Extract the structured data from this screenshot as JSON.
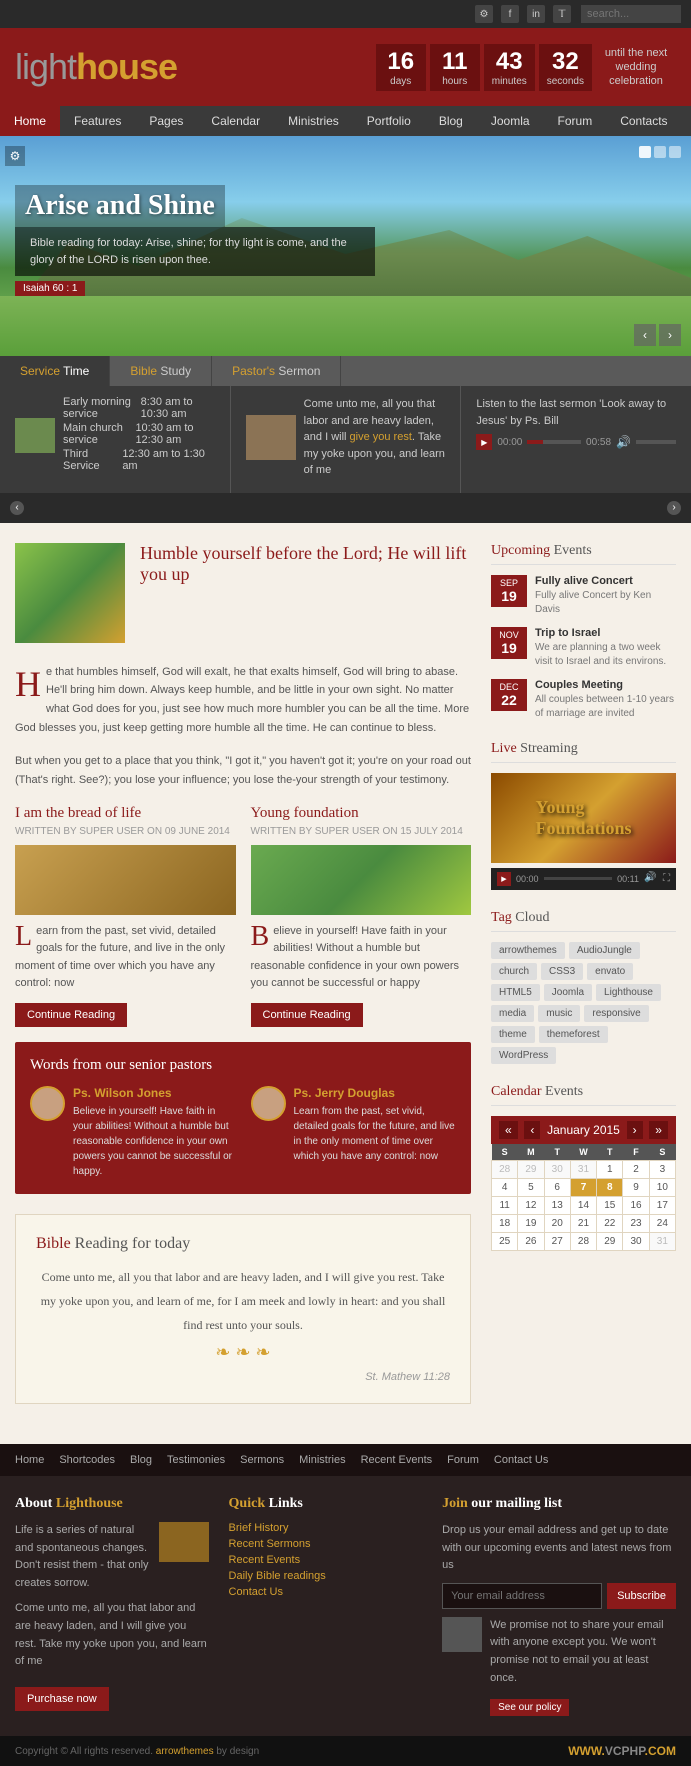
{
  "topbar": {
    "social": [
      "⚙",
      "f",
      "in",
      "𝕏"
    ],
    "search_placeholder": "search..."
  },
  "header": {
    "logo_light": "light",
    "logo_house": "house",
    "countdown": {
      "days": "16",
      "hours": "11",
      "minutes": "43",
      "seconds": "32",
      "days_label": "days",
      "hours_label": "hours",
      "minutes_label": "minutes",
      "seconds_label": "seconds",
      "text": "until the next wedding celebration"
    }
  },
  "nav": {
    "items": [
      "Home",
      "Features",
      "Pages",
      "Calendar",
      "Ministries",
      "Portfolio",
      "Blog",
      "Joomla",
      "Forum",
      "Contacts"
    ]
  },
  "hero": {
    "title": "Arise and Shine",
    "verse": "Bible reading for today: Arise, shine; for thy light is come, and the glory of the LORD is risen upon thee.",
    "reference": "Isaiah 60 : 1"
  },
  "service_section": {
    "tabs": [
      "Service Time",
      "Bible Study",
      "Pastor's Sermon"
    ],
    "services": [
      {
        "name": "Early morning service",
        "time": "8:30 am to 10:30 am"
      },
      {
        "name": "Main church service",
        "time": "10:30 am to 12:30 am"
      },
      {
        "name": "Third Service",
        "time": "12:30 am to 1:30 am"
      }
    ],
    "bible_text": "Come unto me, all you that labor and are heavy laden, and I will give you rest. Take my yoke upon you, and learn of me",
    "bible_link": "give you rest",
    "pastor_text": "Listen to the last sermon 'Look away to Jesus' by Ps. Bill",
    "audio": {
      "time_start": "00:00",
      "time_end": "00:58"
    }
  },
  "featured": {
    "heading": "Humble yourself before the Lord; He will lift you up",
    "body1": "He that humbles himself, God will exalt, he that exalts himself, God will bring to abase. He'll bring him down. Always keep humble, and be little in your own sight. No matter what God does for you, just see how much more humbler you can be all the time. More God blesses you, just keep getting more humble all the time. He can continue to bless.",
    "body2": "But when you get to a place that you think, \"I got it,\" you haven't got it; you're on your road out (That's right. See?); you lose your influence; you lose the-your strength of your testimony."
  },
  "articles": [
    {
      "title": "I am the bread of life",
      "meta": "WRITTEN BY SUPER USER ON 09 JUNE 2014",
      "body": "Learn from the past, set vivid, detailed goals for the future, and live in the only moment of time over which you have any control: now",
      "continue": "Continue Reading"
    },
    {
      "title": "Young foundation",
      "meta": "WRITTEN BY SUPER USER ON 15 JULY 2014",
      "body": "Believe in yourself! Have faith in your abilities! Without a humble but reasonable confidence in your own powers you cannot be successful or happy",
      "continue": "Continue Reading"
    }
  ],
  "pastors": {
    "section_title": "Words from our senior pastors",
    "list": [
      {
        "name": "Ps. Wilson Jones",
        "quote": "Believe in yourself! Have faith in your abilities! Without a humble but reasonable confidence in your own powers you cannot be successful or happy."
      },
      {
        "name": "Ps. Jerry Douglas",
        "quote": "Learn from the past, set vivid, detailed goals for the future, and live in the only moment of time over which you have any control: now"
      }
    ]
  },
  "bible_reading": {
    "title": "Bible Reading for today",
    "text": "Come unto me, all you that labor and are heavy laden, and I will give you rest. Take my yoke upon you, and learn of me, for I am meek and lowly in heart: and you shall find rest unto your souls.",
    "reference": "St. Mathew 11:28"
  },
  "sidebar": {
    "events_title": "Upcoming Events",
    "events": [
      {
        "month": "SEP",
        "day": "19",
        "title": "Fully alive Concert",
        "desc": "Fully alive Concert by Ken Davis"
      },
      {
        "month": "NOV",
        "day": "19",
        "title": "Trip to Israel",
        "desc": "We are planning a two week visit to Israel and its environs."
      },
      {
        "month": "DEC",
        "day": "22",
        "title": "Couples Meeting",
        "desc": "All couples between 1-10 years of marriage are invited"
      }
    ],
    "streaming_title": "Live Streaming",
    "streaming_video_title": "Young Foundations",
    "streaming_time_start": "00:00",
    "streaming_time_end": "00:11",
    "tags_title": "Tag Cloud",
    "tags": [
      "arrowthemes",
      "AudioJungle",
      "church",
      "CSS3",
      "envato",
      "HTML5",
      "Joomla",
      "Lighthouse",
      "media",
      "music",
      "responsive",
      "theme",
      "themeforest",
      "WordPress"
    ],
    "calendar_title": "Calendar Events",
    "calendar_month": "January 2015",
    "calendar_days": [
      "S",
      "M",
      "T",
      "W",
      "T",
      "F",
      "S"
    ],
    "calendar_rows": [
      [
        "28",
        "29",
        "30",
        "31",
        "1",
        "2",
        "3"
      ],
      [
        "4",
        "5",
        "6",
        "7",
        "8",
        "9",
        "10"
      ],
      [
        "11",
        "12",
        "13",
        "14",
        "15",
        "16",
        "17"
      ],
      [
        "18",
        "19",
        "20",
        "21",
        "22",
        "23",
        "24"
      ],
      [
        "25",
        "26",
        "27",
        "28",
        "29",
        "30",
        "31"
      ]
    ],
    "calendar_other_month": [
      "28",
      "29",
      "30",
      "31",
      "28",
      "29",
      "30",
      "31"
    ],
    "calendar_events": [
      "7",
      "8"
    ]
  },
  "footer": {
    "nav_items": [
      "Home",
      "Shortcodes",
      "Blog",
      "Testimonies",
      "Sermons",
      "Ministries",
      "Recent Events",
      "Forum",
      "Contact Us"
    ],
    "about_title": "About Lighthouse",
    "about_text1": "Life is a series of natural and spontaneous changes. Don't resist them - that only creates sorrow.",
    "about_text2": "Come unto me, all you that labor and are heavy laden, and I will give you rest. Take my yoke upon you, and learn of me",
    "about_btn": "Purchase now",
    "links_title": "Quick Links",
    "links": [
      "Brief History",
      "Recent Sermons",
      "Recent Events",
      "Daily Bible readings",
      "Contact Us"
    ],
    "mailing_title": "Join our mailing list",
    "mailing_desc": "Drop us your email address and get up to date with our upcoming events and latest news from us",
    "email_placeholder": "Your email address",
    "subscribe_btn": "Subscribe",
    "policy_text": "We promise not to share your email with anyone except you. We won't promise not to email you at least once.",
    "see_policy": "See our policy",
    "copyright": "Copyright © All rights reserved. arrowthemes by design",
    "brand": "WWW.VCPHP.COM"
  },
  "colors": {
    "primary": "#8b1a1a",
    "accent": "#d4a030",
    "dark": "#2a2a2a",
    "light_bg": "#f5f0e8"
  }
}
